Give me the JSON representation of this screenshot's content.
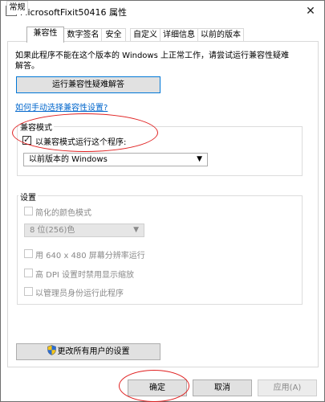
{
  "window": {
    "title": "MicrosoftFixit50416 属性",
    "close_glyph": "✕"
  },
  "tabs": [
    {
      "label": "常规"
    },
    {
      "label": "兼容性"
    },
    {
      "label": "数字签名"
    },
    {
      "label": "安全"
    },
    {
      "label": "自定义"
    },
    {
      "label": "详细信息"
    },
    {
      "label": "以前的版本"
    }
  ],
  "intro": {
    "text": "如果此程序不能在这个版本的 Windows 上正常工作，请尝试运行兼容性疑难解答。"
  },
  "troubleshooter_button": "运行兼容性疑难解答",
  "manual_link": "如何手动选择兼容性设置?",
  "compat_group": {
    "label": "兼容模式",
    "checkbox_label": "以兼容模式运行这个程序:",
    "checked": true,
    "os_select_value": "以前版本的 Windows"
  },
  "settings_group": {
    "label": "设置",
    "reduced_color_label": "简化的颜色模式",
    "color_select_value": "8 位(256)色",
    "res_640_label": "用 640 x 480 屏幕分辨率运行",
    "high_dpi_label": "高 DPI 设置时禁用显示缩放",
    "run_as_admin_label": "以管理员身份运行此程序"
  },
  "all_users_button": "更改所有用户的设置",
  "footer": {
    "ok": "确定",
    "cancel": "取消",
    "apply": "应用(A)"
  },
  "icons": {
    "window": "program-properties-icon",
    "shield": "uac-shield-icon",
    "arrow": "chevron-down-icon"
  },
  "colors": {
    "link": "#0066cc",
    "annotation": "#e02020",
    "focus_border": "#0078d7"
  }
}
